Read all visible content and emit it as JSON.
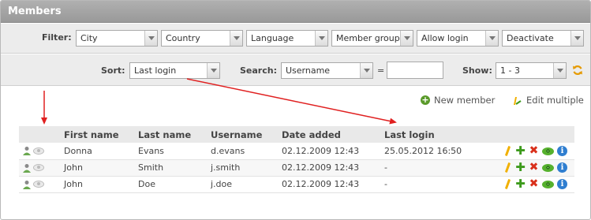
{
  "panel": {
    "title": "Members"
  },
  "filter": {
    "label": "Filter:",
    "selects": [
      "City",
      "Country",
      "Language",
      "Member groups",
      "Allow login",
      "Deactivate"
    ]
  },
  "sort": {
    "label": "Sort:",
    "value": "Last login"
  },
  "search": {
    "label": "Search:",
    "field": "Username",
    "eq": "=",
    "value": ""
  },
  "show": {
    "label": "Show:",
    "value": "1 - 3"
  },
  "actions": {
    "new_member": "New member",
    "edit_multiple": "Edit multiple"
  },
  "table": {
    "headers": [
      "First name",
      "Last name",
      "Username",
      "Date added",
      "Last login"
    ],
    "rows": [
      [
        "Donna",
        "Evans",
        "d.evans",
        "02.12.2009 12:43",
        "25.05.2012 16:50"
      ],
      [
        "John",
        "Smith",
        "j.smith",
        "02.12.2009 12:43",
        "-"
      ],
      [
        "John",
        "Doe",
        "j.doe",
        "02.12.2009 12:43",
        "-"
      ]
    ]
  },
  "colors": {
    "annotation": "#e02020",
    "title_bar": "#a6a6a6"
  }
}
